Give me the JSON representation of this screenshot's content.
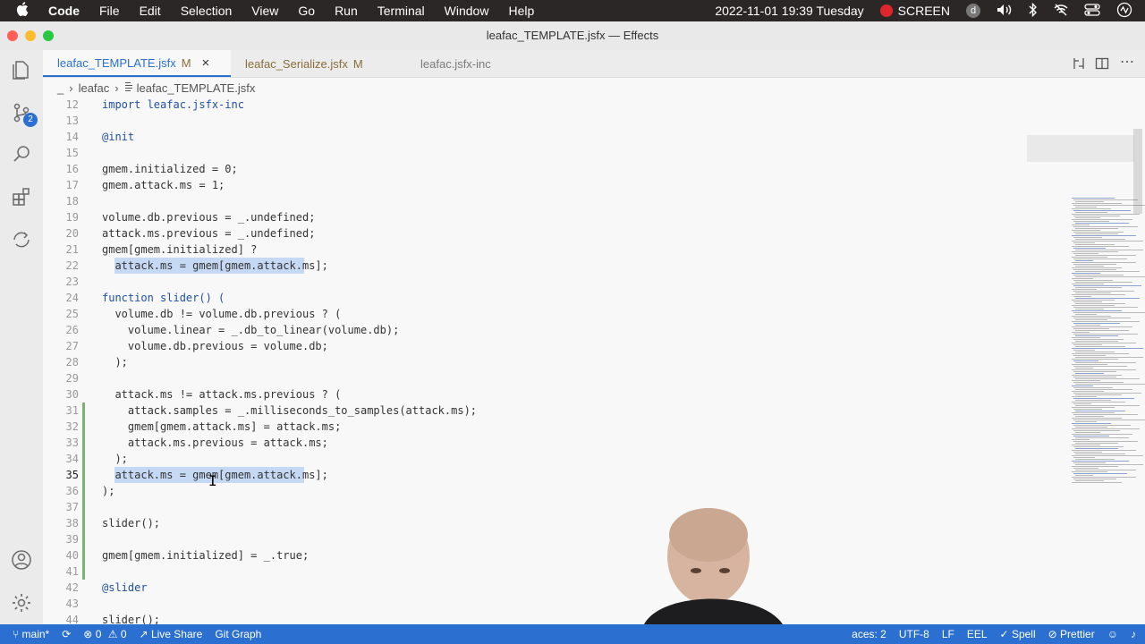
{
  "menubar": {
    "app": "Code",
    "items": [
      "File",
      "Edit",
      "Selection",
      "View",
      "Go",
      "Run",
      "Terminal",
      "Window",
      "Help"
    ],
    "datetime": "2022-11-01 19:39 Tuesday",
    "screen": "SCREEN",
    "user_initial": "d"
  },
  "window": {
    "title": "leafac_TEMPLATE.jsfx — Effects"
  },
  "tabs": [
    {
      "label": "leafac_TEMPLATE.jsfx",
      "modified": "M"
    },
    {
      "label": "leafac_Serialize.jsfx",
      "modified": "M"
    },
    {
      "label": "leafac.jsfx-inc",
      "modified": ""
    }
  ],
  "breadcrumb": {
    "root": "_",
    "folder": "leafac",
    "file": "leafac_TEMPLATE.jsfx"
  },
  "activity": {
    "scm_badge": "2"
  },
  "editor": {
    "lines": [
      {
        "n": "12",
        "text": "import leafac.jsfx-inc"
      },
      {
        "n": "13",
        "text": ""
      },
      {
        "n": "14",
        "text": "@init"
      },
      {
        "n": "15",
        "text": ""
      },
      {
        "n": "16",
        "text": "gmem.initialized = 0;"
      },
      {
        "n": "17",
        "text": "gmem.attack.ms = 1;"
      },
      {
        "n": "18",
        "text": ""
      },
      {
        "n": "19",
        "text": "volume.db.previous = _.undefined;"
      },
      {
        "n": "20",
        "text": "attack.ms.previous = _.undefined;"
      },
      {
        "n": "21",
        "text": "gmem[gmem.initialized] ?"
      },
      {
        "n": "22",
        "text": "  attack.ms = gmem[gmem.attack.ms];"
      },
      {
        "n": "23",
        "text": ""
      },
      {
        "n": "24",
        "text": "function slider() ("
      },
      {
        "n": "25",
        "text": "  volume.db != volume.db.previous ? ("
      },
      {
        "n": "26",
        "text": "    volume.linear = _.db_to_linear(volume.db);"
      },
      {
        "n": "27",
        "text": "    volume.db.previous = volume.db;"
      },
      {
        "n": "28",
        "text": "  );"
      },
      {
        "n": "29",
        "text": ""
      },
      {
        "n": "30",
        "text": "  attack.ms != attack.ms.previous ? ("
      },
      {
        "n": "31",
        "text": "    attack.samples = _.milliseconds_to_samples(attack.ms);"
      },
      {
        "n": "32",
        "text": "    gmem[gmem.attack.ms] = attack.ms;"
      },
      {
        "n": "33",
        "text": "    attack.ms.previous = attack.ms;"
      },
      {
        "n": "34",
        "text": "  );"
      },
      {
        "n": "35",
        "text": "  attack.ms = gmem[gmem.attack.ms];"
      },
      {
        "n": "36",
        "text": ");"
      },
      {
        "n": "37",
        "text": ""
      },
      {
        "n": "38",
        "text": "slider();"
      },
      {
        "n": "39",
        "text": ""
      },
      {
        "n": "40",
        "text": "gmem[gmem.initialized] = _.true;"
      },
      {
        "n": "41",
        "text": ""
      },
      {
        "n": "42",
        "text": "@slider"
      },
      {
        "n": "43",
        "text": ""
      },
      {
        "n": "44",
        "text": "slider();"
      }
    ]
  },
  "statusbar": {
    "branch": "main*",
    "errors": "0",
    "warnings": "0",
    "live_share": "Live Share",
    "git_graph": "Git Graph",
    "spaces": "aces: 2",
    "encoding": "UTF-8",
    "eol": "LF",
    "lang": "EEL",
    "spell": "Spell",
    "prettier": "Prettier"
  },
  "colors": {
    "accent": "#2b6fd1",
    "selection": "#c6d9f4",
    "menubar": "#2b2727"
  }
}
